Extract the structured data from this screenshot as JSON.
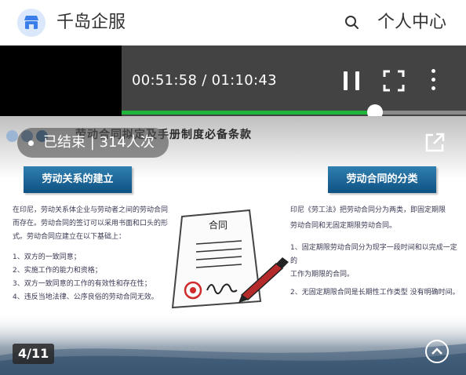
{
  "header": {
    "brand": "千岛企服",
    "user_center": "个人中心",
    "logo_icon": "store-icon",
    "search_icon": "search-icon"
  },
  "player": {
    "time_display": "00:51:58 / 01:10:43",
    "progress_fraction": 0.7349,
    "progress_color": "#1fb53a",
    "status_badge": "已结束 | 314人次",
    "page_indicator": "4/11"
  },
  "slide": {
    "title": "劳动合同拟定及手册制度必备条款",
    "left_section": {
      "heading": "劳动关系的建立",
      "intro": [
        "在印尼，劳动关系体企业与劳动者之间的劳动合同",
        "而存在。劳动合同的签订可以采用书面和口头的形",
        "式。劳动合同应建立在以下基础上："
      ],
      "items": [
        "1、双方的一致同意；",
        "2、实施工作的能力和资格；",
        "3、双方一致同意的工作的有效性和存在性；",
        "4、违反当地法律、公序良俗的劳动合同无效。"
      ]
    },
    "right_section": {
      "heading": "劳动合同的分类",
      "intro": [
        "印尼《劳工法》把劳动合同分为两类，即固定期限",
        "劳动合同和无固定期限劳动合同。"
      ],
      "items": [
        "1、固定期限劳动合同分为现字一段时间和以完成一定的",
        "工作为期限的合同。",
        "2、无固定期限合同是长期性工作类型 没有明确时间。"
      ]
    },
    "illustration_text": "合同",
    "accent_color": "#0e5283"
  }
}
